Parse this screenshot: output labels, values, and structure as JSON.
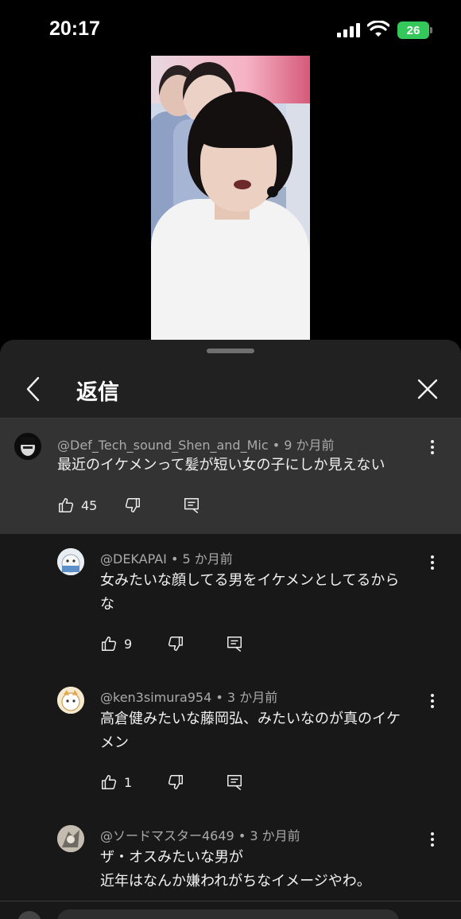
{
  "status_bar": {
    "time": "20:17",
    "battery": "26"
  },
  "panel": {
    "title": "返信"
  },
  "parent_comment": {
    "author": "@Def_Tech_sound_Shen_and_Mic",
    "age": "9 か月前",
    "text": "最近のイケメンって髪が短い女の子にしか見えない",
    "likes": "45"
  },
  "replies": [
    {
      "author": "@DEKAPAI",
      "age": "5 か月前",
      "lines": [
        "女みたいな顔してる男をイケメンとしてるから",
        "な"
      ],
      "likes": "9"
    },
    {
      "author": "@ken3simura954",
      "age": "3 か月前",
      "lines": [
        "高倉健みたいな藤岡弘、みたいなのが真のイケ",
        "メン"
      ],
      "likes": "1"
    },
    {
      "author": "@ソードマスター4649",
      "age": "3 か月前",
      "lines": [
        "ザ・オスみたいな男が",
        "近年はなんか嫌われがちなイメージやわ。"
      ],
      "likes": ""
    }
  ],
  "separator": "•",
  "colors": {
    "panel_bg": "#212121",
    "highlight_bg": "#333333",
    "battery_green": "#34c759"
  }
}
